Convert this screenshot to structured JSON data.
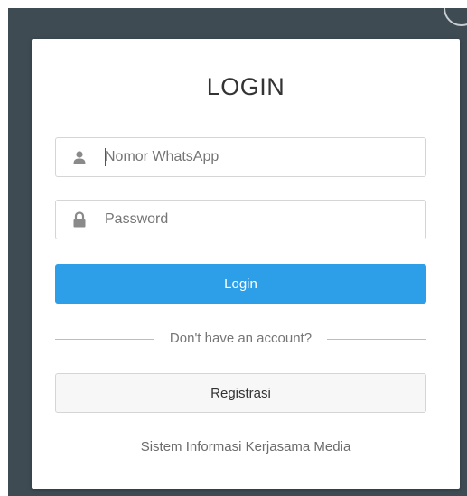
{
  "login_form": {
    "title": "LOGIN",
    "phone_field": {
      "placeholder": "Nomor WhatsApp",
      "value": "",
      "icon": "user-icon"
    },
    "password_field": {
      "placeholder": "Password",
      "value": "",
      "icon": "lock-icon"
    },
    "login_button_label": "Login",
    "divider_text": "Don't have an account?",
    "register_button_label": "Registrasi",
    "footer_text": "Sistem Informasi Kerjasama Media"
  },
  "colors": {
    "backdrop": "#3e4b53",
    "primary_button": "#2d9ee8",
    "secondary_button": "#f7f7f7"
  }
}
